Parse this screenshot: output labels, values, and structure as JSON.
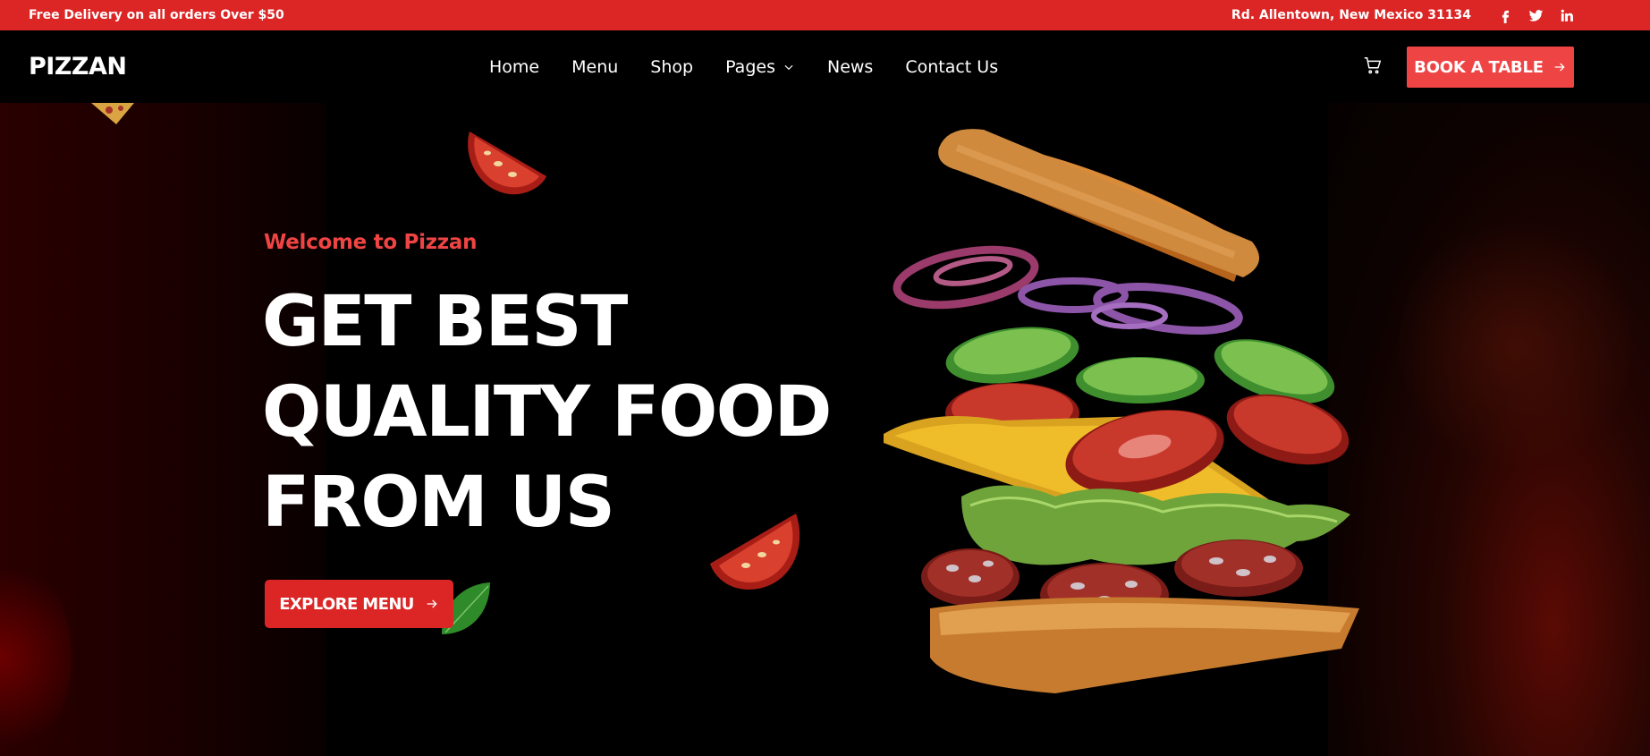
{
  "topbar": {
    "promo": "Free Delivery on all orders Over $50",
    "address": "Rd. Allentown, New Mexico 31134",
    "social": [
      "facebook-icon",
      "twitter-icon",
      "linkedin-icon"
    ]
  },
  "header": {
    "logo": "PIZZAN",
    "nav": [
      "Home",
      "Menu",
      "Shop",
      "Pages",
      "News",
      "Contact Us"
    ],
    "cart_icon": "cart-icon",
    "book_label": "BOOK A TABLE"
  },
  "hero": {
    "welcome": "Welcome to Pizzan",
    "headline_lines": [
      "GET BEST",
      "QUALITY FOOD",
      "FROM US"
    ],
    "explore_label": "EXPLORE MENU"
  },
  "colors": {
    "accent": "#dc2626",
    "accent_button": "#ef4444",
    "background": "#000000"
  }
}
